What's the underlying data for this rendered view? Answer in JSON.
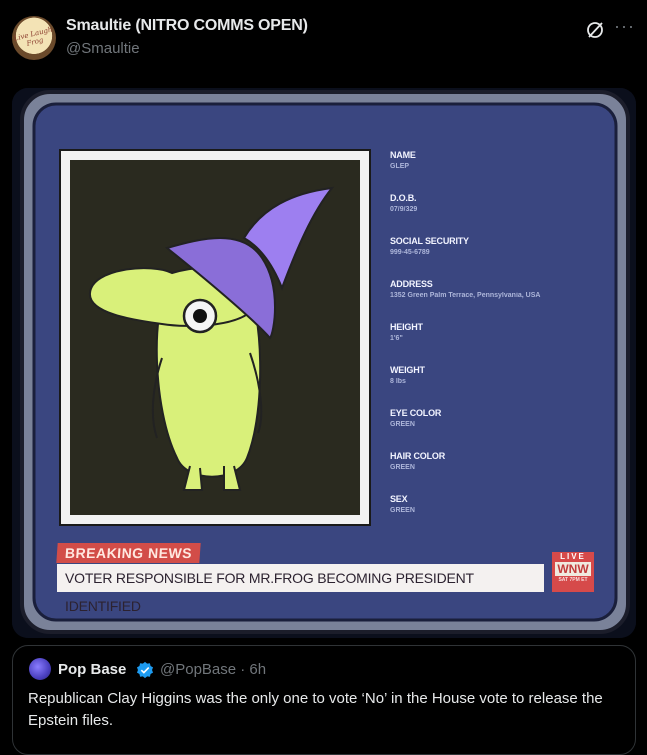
{
  "post": {
    "display_name": "Smaultie (NITRO COMMS OPEN)",
    "handle": "@Smaultie",
    "avatar_text": "Live Laugh Frog",
    "icons": {
      "grok": "grok-icon",
      "more": "more-icon"
    },
    "more_glyph": "···"
  },
  "media": {
    "profile_fields": [
      {
        "name": "NAME",
        "value": "GLEP"
      },
      {
        "name": "D.O.B.",
        "value": "07/9/329"
      },
      {
        "name": "SOCIAL SECURITY",
        "value": "999-45-6789"
      },
      {
        "name": "ADDRESS",
        "value": "1352 Green Palm Terrace, Pennsylvania, USA"
      },
      {
        "name": "HEIGHT",
        "value": "1'6\""
      },
      {
        "name": "WEIGHT",
        "value": "8 lbs"
      },
      {
        "name": "EYE COLOR",
        "value": "GREEN"
      },
      {
        "name": "HAIR COLOR",
        "value": "GREEN"
      },
      {
        "name": "SEX",
        "value": "GREEN"
      }
    ],
    "breaking_label": "BREAKING NEWS",
    "ticker_text": "VOTER RESPONSIBLE FOR MR.FROG BECOMING PRESIDENT IDENTIFIED",
    "live_badge": {
      "top": "LIVE",
      "logo": "WNW",
      "bottom": "SAT 7PM ET"
    }
  },
  "quote": {
    "display_name": "Pop Base",
    "handle_time": "@PopBase · 6h",
    "text": "Republican Clay Higgins was the only one to vote ‘No’ in the House vote to release the Epstein files.",
    "verified_color": "#1d9bf0"
  },
  "colors": {
    "accent": "#1d9bf0",
    "breaking_red": "#d24d48",
    "monitor_blue": "#3a4680"
  }
}
